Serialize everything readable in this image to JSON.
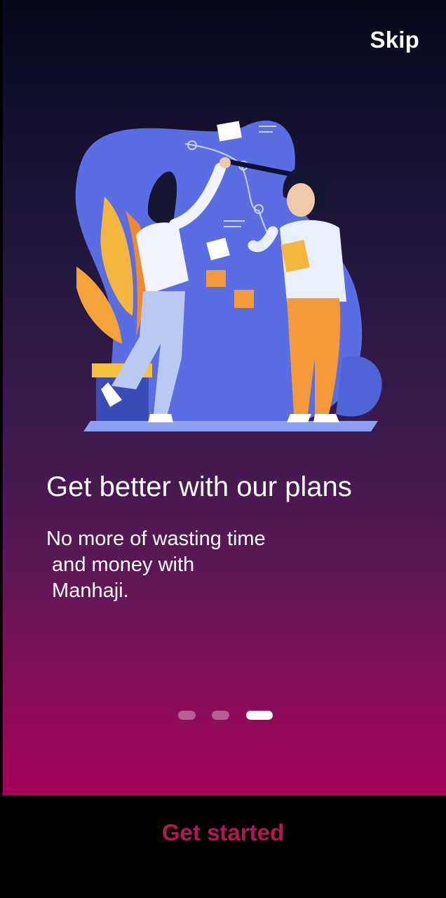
{
  "onboarding": {
    "skip_label": "Skip",
    "title": "Get better with our plans",
    "description_lines": [
      "No more of wasting time",
      " and money with",
      " Manhaji."
    ],
    "page_indicator": {
      "total": 3,
      "active": 3
    },
    "cta_label": "Get started"
  },
  "colors": {
    "gradient_top": "#07091a",
    "gradient_bottom": "#a5005a",
    "accent": "#b3175a",
    "illustration_blob": "#5b6de0"
  },
  "illustration": {
    "icon": "team-planning-illustration"
  }
}
